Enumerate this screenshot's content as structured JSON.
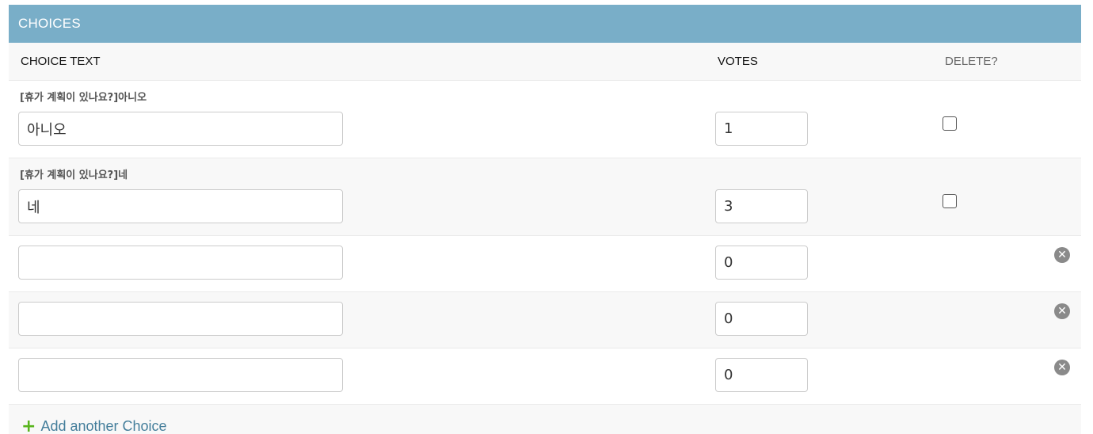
{
  "module": {
    "caption": "CHOICES",
    "headers": {
      "choice_text": "CHOICE TEXT",
      "votes": "VOTES",
      "delete": "DELETE?"
    },
    "existing_rows": [
      {
        "original": "[휴가 계획이 있나요?]아니오",
        "choice_text": "아니오",
        "votes": "1",
        "delete_checked": false
      },
      {
        "original": "[휴가 계획이 있나요?]네",
        "choice_text": "네",
        "votes": "3",
        "delete_checked": false
      }
    ],
    "extra_rows": [
      {
        "choice_text": "",
        "votes": "0",
        "remove_icon": "remove-circle-x-icon"
      },
      {
        "choice_text": "",
        "votes": "0",
        "remove_icon": "remove-circle-x-icon"
      },
      {
        "choice_text": "",
        "votes": "0",
        "remove_icon": "remove-circle-x-icon"
      }
    ],
    "add_link": "Add another Choice",
    "add_icon": "plus-icon"
  },
  "colors": {
    "caption_bg": "#79aec8",
    "row_alt_bg": "#f8f8f8",
    "link": "#447e9b",
    "add_icon": "#58b51d"
  }
}
